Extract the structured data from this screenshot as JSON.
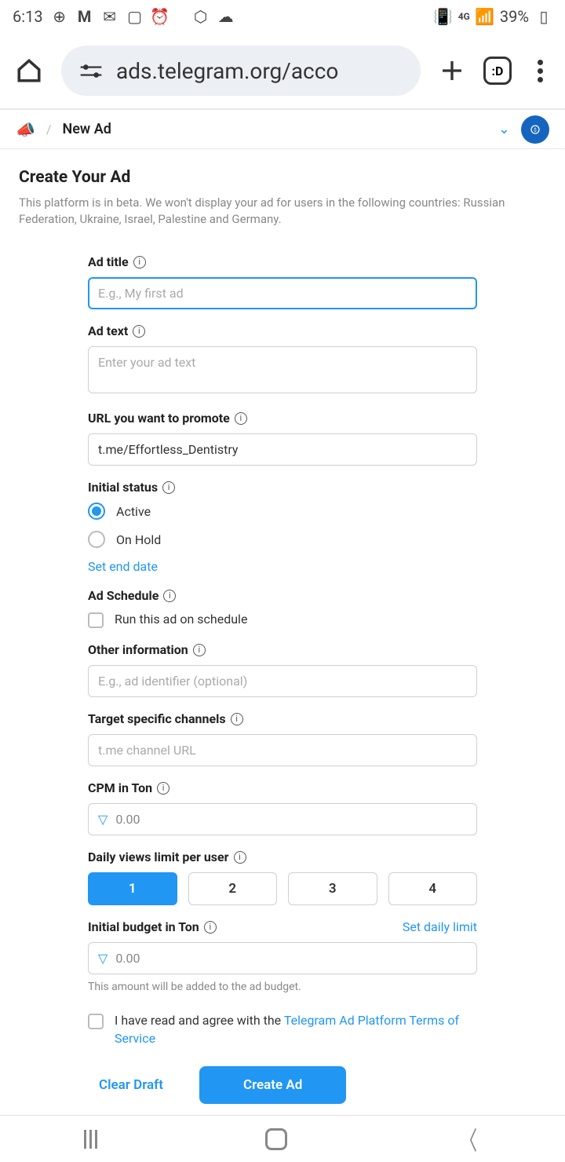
{
  "status": {
    "time": "6:13",
    "battery": "39%",
    "network": "4G"
  },
  "browser": {
    "url": "ads.telegram.org/acco",
    "tabs": ":D"
  },
  "breadcrumb": {
    "current": "New Ad"
  },
  "page": {
    "title": "Create Your Ad",
    "subtitle": "This platform is in beta. We won't display your ad for users in the following countries: Russian Federation, Ukraine, Israel, Palestine and Germany."
  },
  "form": {
    "adTitle": {
      "label": "Ad title",
      "placeholder": "E.g., My first ad",
      "value": ""
    },
    "adText": {
      "label": "Ad text",
      "placeholder": "Enter your ad text",
      "value": ""
    },
    "url": {
      "label": "URL you want to promote",
      "value": "t.me/Effortless_Dentistry"
    },
    "initialStatus": {
      "label": "Initial status",
      "active": "Active",
      "onHold": "On Hold",
      "setEndDate": "Set end date"
    },
    "schedule": {
      "label": "Ad Schedule",
      "checkbox": "Run this ad on schedule"
    },
    "otherInfo": {
      "label": "Other information",
      "placeholder": "E.g., ad identifier (optional)"
    },
    "targetChannels": {
      "label": "Target specific channels",
      "placeholder": "t.me channel URL"
    },
    "cpm": {
      "label": "CPM in Ton",
      "value": "0.00"
    },
    "dailyViews": {
      "label": "Daily views limit per user",
      "options": [
        "1",
        "2",
        "3",
        "4"
      ],
      "selected": "1"
    },
    "budget": {
      "label": "Initial budget in Ton",
      "dailyLimit": "Set daily limit",
      "value": "0.00",
      "help": "This amount will be added to the ad budget."
    },
    "tos": {
      "prefix": "I have read and agree with the ",
      "linkText": "Telegram Ad Platform Terms of Service"
    },
    "actions": {
      "clear": "Clear Draft",
      "create": "Create Ad"
    }
  }
}
